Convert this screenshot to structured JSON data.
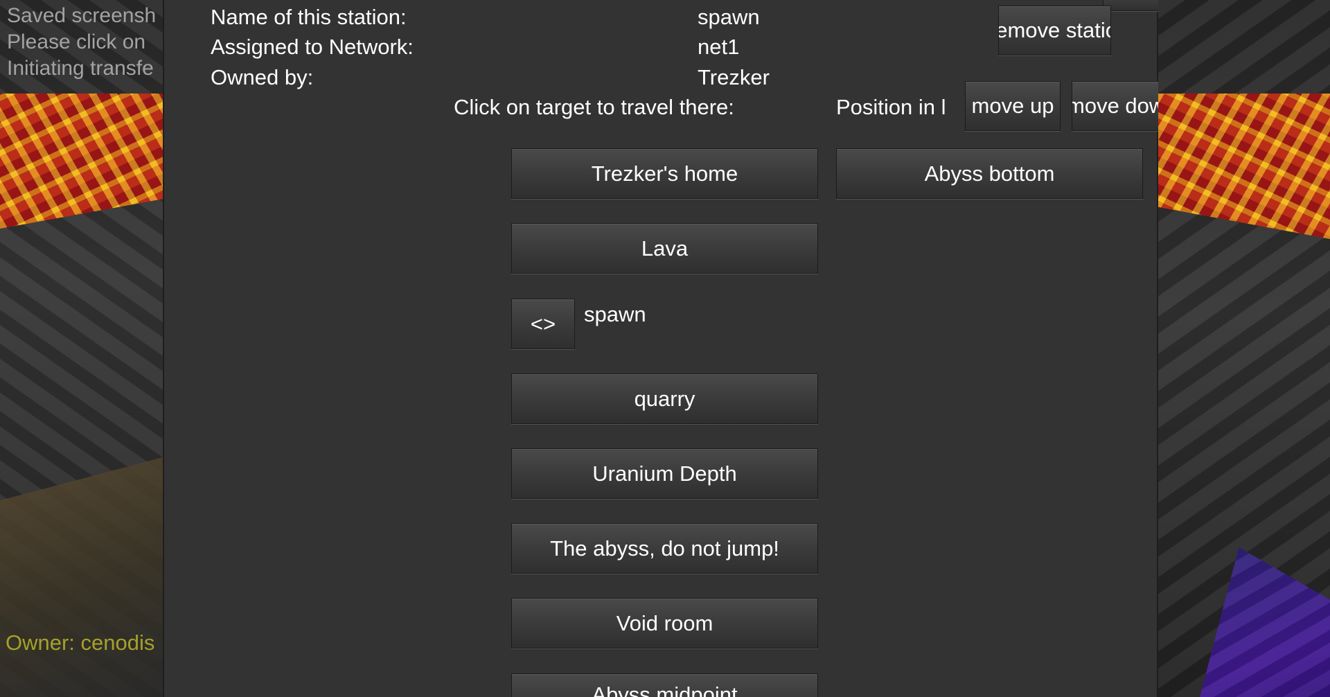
{
  "hud": {
    "chat_lines": [
      "Saved screensh",
      "Please click on",
      "Initiating transfe"
    ],
    "owner_text": "Owner: cenodis"
  },
  "station": {
    "name_label": "Name of this station:",
    "name_value": "spawn",
    "network_label": "Assigned to Network:",
    "network_value": "net1",
    "owner_label": "Owned by:",
    "owner_value": "Trezker",
    "remove_label": "Remove station"
  },
  "targets": {
    "header": "Click on target to travel there:",
    "items": [
      "Trezker's home",
      "Lava",
      "quarry",
      "Uranium Depth",
      "The abyss, do not jump!",
      "Void room",
      "Abyss midpoint"
    ],
    "current": {
      "toggle_label": "<>",
      "name": "spawn"
    }
  },
  "position": {
    "label": "Position in lis",
    "move_up": "move up",
    "move_down": "move dowi",
    "selected_station": "Abyss bottom"
  },
  "colors": {
    "panel": "#333333",
    "chat": "#a3a3a3",
    "owner": "#a6a12a"
  }
}
